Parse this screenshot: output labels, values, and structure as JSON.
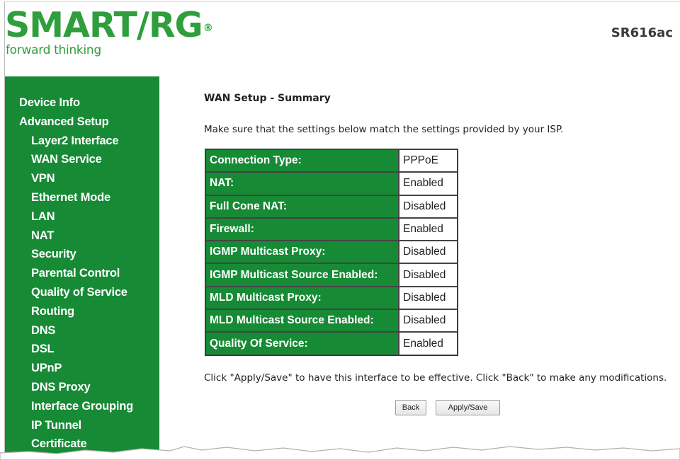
{
  "header": {
    "logo_text": "SMART/RG",
    "logo_reg": "®",
    "tagline": "forward thinking",
    "model": "SR616ac"
  },
  "sidebar": {
    "items": [
      {
        "label": "Device Info",
        "level": "top"
      },
      {
        "label": "Advanced Setup",
        "level": "top"
      },
      {
        "label": "Layer2 Interface",
        "level": "sub"
      },
      {
        "label": "WAN Service",
        "level": "sub"
      },
      {
        "label": "VPN",
        "level": "sub"
      },
      {
        "label": "Ethernet Mode",
        "level": "sub"
      },
      {
        "label": "LAN",
        "level": "sub"
      },
      {
        "label": "NAT",
        "level": "sub"
      },
      {
        "label": "Security",
        "level": "sub"
      },
      {
        "label": "Parental Control",
        "level": "sub"
      },
      {
        "label": "Quality of Service",
        "level": "sub"
      },
      {
        "label": "Routing",
        "level": "sub"
      },
      {
        "label": "DNS",
        "level": "sub"
      },
      {
        "label": "DSL",
        "level": "sub"
      },
      {
        "label": "UPnP",
        "level": "sub"
      },
      {
        "label": "DNS Proxy",
        "level": "sub"
      },
      {
        "label": "Interface Grouping",
        "level": "sub"
      },
      {
        "label": "IP Tunnel",
        "level": "sub"
      },
      {
        "label": "Certificate",
        "level": "sub"
      }
    ]
  },
  "main": {
    "title": "WAN Setup - Summary",
    "intro": "Make sure that the settings below match the settings provided by your ISP.",
    "rows": [
      {
        "label": "Connection Type:",
        "value": "PPPoE"
      },
      {
        "label": "NAT:",
        "value": "Enabled"
      },
      {
        "label": "Full Cone NAT:",
        "value": "Disabled"
      },
      {
        "label": "Firewall:",
        "value": "Enabled"
      },
      {
        "label": "IGMP Multicast Proxy:",
        "value": "Disabled"
      },
      {
        "label": "IGMP Multicast Source Enabled:",
        "value": "Disabled"
      },
      {
        "label": "MLD Multicast Proxy:",
        "value": "Disabled"
      },
      {
        "label": "MLD Multicast Source Enabled:",
        "value": "Disabled"
      },
      {
        "label": "Quality Of Service:",
        "value": "Enabled"
      }
    ],
    "footer": "Click \"Apply/Save\" to have this interface to be effective. Click \"Back\" to make any modifications.",
    "buttons": {
      "back": "Back",
      "apply_save": "Apply/Save"
    }
  },
  "colors": {
    "brand_green": "#2f9e3c",
    "sidebar_green": "#178a35"
  }
}
